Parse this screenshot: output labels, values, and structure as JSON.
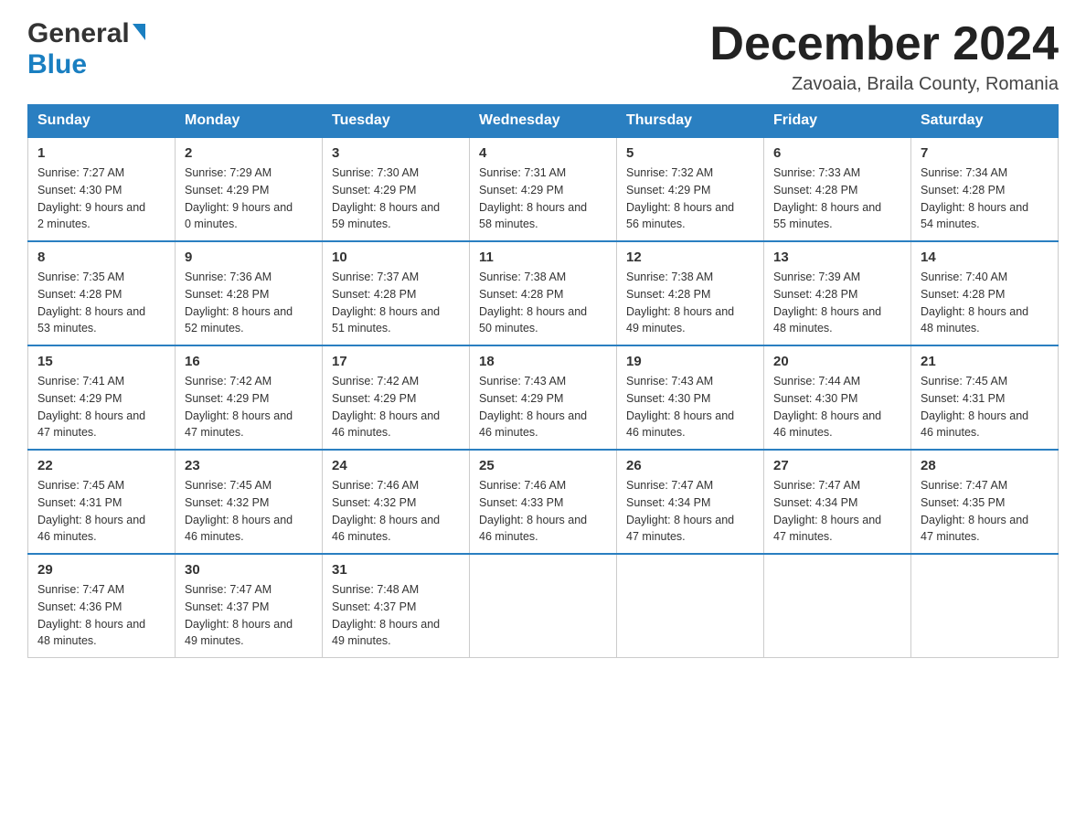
{
  "header": {
    "logo": {
      "line1": "General",
      "line2": "Blue"
    },
    "title": "December 2024",
    "location": "Zavoaia, Braila County, Romania"
  },
  "days_of_week": [
    "Sunday",
    "Monday",
    "Tuesday",
    "Wednesday",
    "Thursday",
    "Friday",
    "Saturday"
  ],
  "weeks": [
    [
      {
        "day": "1",
        "sunrise": "7:27 AM",
        "sunset": "4:30 PM",
        "daylight": "9 hours and 2 minutes."
      },
      {
        "day": "2",
        "sunrise": "7:29 AM",
        "sunset": "4:29 PM",
        "daylight": "9 hours and 0 minutes."
      },
      {
        "day": "3",
        "sunrise": "7:30 AM",
        "sunset": "4:29 PM",
        "daylight": "8 hours and 59 minutes."
      },
      {
        "day": "4",
        "sunrise": "7:31 AM",
        "sunset": "4:29 PM",
        "daylight": "8 hours and 58 minutes."
      },
      {
        "day": "5",
        "sunrise": "7:32 AM",
        "sunset": "4:29 PM",
        "daylight": "8 hours and 56 minutes."
      },
      {
        "day": "6",
        "sunrise": "7:33 AM",
        "sunset": "4:28 PM",
        "daylight": "8 hours and 55 minutes."
      },
      {
        "day": "7",
        "sunrise": "7:34 AM",
        "sunset": "4:28 PM",
        "daylight": "8 hours and 54 minutes."
      }
    ],
    [
      {
        "day": "8",
        "sunrise": "7:35 AM",
        "sunset": "4:28 PM",
        "daylight": "8 hours and 53 minutes."
      },
      {
        "day": "9",
        "sunrise": "7:36 AM",
        "sunset": "4:28 PM",
        "daylight": "8 hours and 52 minutes."
      },
      {
        "day": "10",
        "sunrise": "7:37 AM",
        "sunset": "4:28 PM",
        "daylight": "8 hours and 51 minutes."
      },
      {
        "day": "11",
        "sunrise": "7:38 AM",
        "sunset": "4:28 PM",
        "daylight": "8 hours and 50 minutes."
      },
      {
        "day": "12",
        "sunrise": "7:38 AM",
        "sunset": "4:28 PM",
        "daylight": "8 hours and 49 minutes."
      },
      {
        "day": "13",
        "sunrise": "7:39 AM",
        "sunset": "4:28 PM",
        "daylight": "8 hours and 48 minutes."
      },
      {
        "day": "14",
        "sunrise": "7:40 AM",
        "sunset": "4:28 PM",
        "daylight": "8 hours and 48 minutes."
      }
    ],
    [
      {
        "day": "15",
        "sunrise": "7:41 AM",
        "sunset": "4:29 PM",
        "daylight": "8 hours and 47 minutes."
      },
      {
        "day": "16",
        "sunrise": "7:42 AM",
        "sunset": "4:29 PM",
        "daylight": "8 hours and 47 minutes."
      },
      {
        "day": "17",
        "sunrise": "7:42 AM",
        "sunset": "4:29 PM",
        "daylight": "8 hours and 46 minutes."
      },
      {
        "day": "18",
        "sunrise": "7:43 AM",
        "sunset": "4:29 PM",
        "daylight": "8 hours and 46 minutes."
      },
      {
        "day": "19",
        "sunrise": "7:43 AM",
        "sunset": "4:30 PM",
        "daylight": "8 hours and 46 minutes."
      },
      {
        "day": "20",
        "sunrise": "7:44 AM",
        "sunset": "4:30 PM",
        "daylight": "8 hours and 46 minutes."
      },
      {
        "day": "21",
        "sunrise": "7:45 AM",
        "sunset": "4:31 PM",
        "daylight": "8 hours and 46 minutes."
      }
    ],
    [
      {
        "day": "22",
        "sunrise": "7:45 AM",
        "sunset": "4:31 PM",
        "daylight": "8 hours and 46 minutes."
      },
      {
        "day": "23",
        "sunrise": "7:45 AM",
        "sunset": "4:32 PM",
        "daylight": "8 hours and 46 minutes."
      },
      {
        "day": "24",
        "sunrise": "7:46 AM",
        "sunset": "4:32 PM",
        "daylight": "8 hours and 46 minutes."
      },
      {
        "day": "25",
        "sunrise": "7:46 AM",
        "sunset": "4:33 PM",
        "daylight": "8 hours and 46 minutes."
      },
      {
        "day": "26",
        "sunrise": "7:47 AM",
        "sunset": "4:34 PM",
        "daylight": "8 hours and 47 minutes."
      },
      {
        "day": "27",
        "sunrise": "7:47 AM",
        "sunset": "4:34 PM",
        "daylight": "8 hours and 47 minutes."
      },
      {
        "day": "28",
        "sunrise": "7:47 AM",
        "sunset": "4:35 PM",
        "daylight": "8 hours and 47 minutes."
      }
    ],
    [
      {
        "day": "29",
        "sunrise": "7:47 AM",
        "sunset": "4:36 PM",
        "daylight": "8 hours and 48 minutes."
      },
      {
        "day": "30",
        "sunrise": "7:47 AM",
        "sunset": "4:37 PM",
        "daylight": "8 hours and 49 minutes."
      },
      {
        "day": "31",
        "sunrise": "7:48 AM",
        "sunset": "4:37 PM",
        "daylight": "8 hours and 49 minutes."
      },
      null,
      null,
      null,
      null
    ]
  ],
  "labels": {
    "sunrise_prefix": "Sunrise: ",
    "sunset_prefix": "Sunset: ",
    "daylight_prefix": "Daylight: "
  }
}
